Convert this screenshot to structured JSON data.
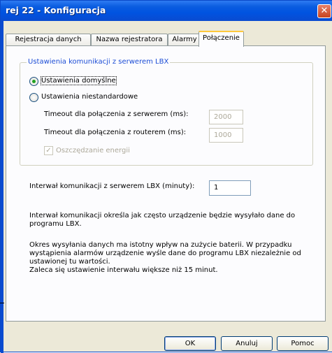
{
  "window": {
    "title": "rej 22 - Konfiguracja",
    "close_glyph": "✕"
  },
  "tabs": [
    {
      "label": "Rejestracja danych"
    },
    {
      "label": "Nazwa rejestratora"
    },
    {
      "label": "Alarmy"
    },
    {
      "label": "Połączenie",
      "active": true
    }
  ],
  "group": {
    "title": "Ustawienia komunikacji z serwerem LBX",
    "radio_default": "Ustawienia domyślne",
    "radio_custom": "Ustawienia niestandardowe",
    "timeout_server_label": "Timeout dla połączenia z serwerem (ms):",
    "timeout_server_value": "2000",
    "timeout_router_label": "Timeout dla połączenia z routerem (ms):",
    "timeout_router_value": "1000",
    "energy_label": "Oszczędzanie energii",
    "energy_checked": true
  },
  "interval": {
    "label": "Interwał komunikacji z serwerem LBX (minuty):",
    "value": "1"
  },
  "info": {
    "p1": "Interwał komunikacji określa jak często urządzenie będzie wysyłało dane do programu LBX.",
    "p2": "Okres wysyłania danych ma istotny wpływ na zużycie baterii. W przypadku wystąpienia alarmów urządzenie wyśle dane do programu LBX niezależnie od ustawionej tu wartości.",
    "p3": "Zaleca się ustawienie interwału większe niż 15 minut."
  },
  "buttons": {
    "ok": "OK",
    "cancel": "Anuluj",
    "help": "Pomoc"
  },
  "colors": {
    "titlebar": "#0053e0",
    "dialog_bg": "#ece9d8",
    "group_title": "#1c4dd6",
    "active_tab_accent": "#ffc83c"
  }
}
